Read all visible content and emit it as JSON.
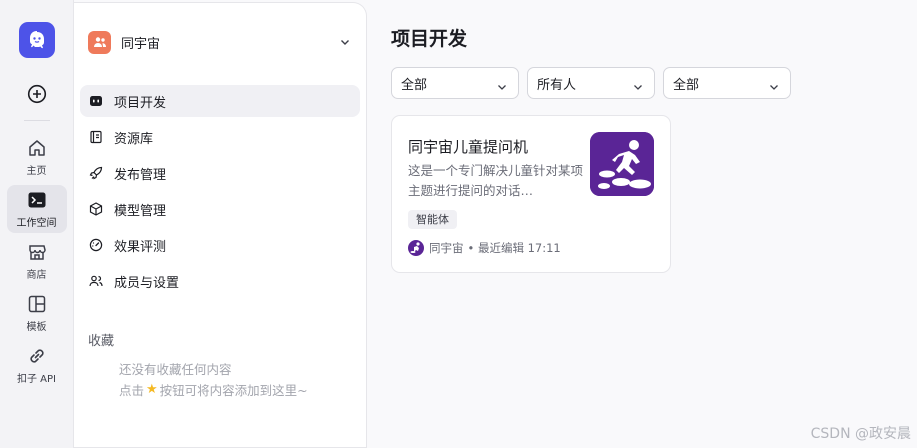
{
  "rail": {
    "items": [
      {
        "label": "主页",
        "icon": "home-icon"
      },
      {
        "label": "工作空间",
        "icon": "terminal-icon"
      },
      {
        "label": "商店",
        "icon": "store-icon"
      },
      {
        "label": "模板",
        "icon": "template-icon"
      },
      {
        "label": "扣子 API",
        "icon": "link-icon"
      }
    ]
  },
  "space": {
    "name": "同宇宙"
  },
  "nav": {
    "items": [
      {
        "label": "项目开发"
      },
      {
        "label": "资源库"
      },
      {
        "label": "发布管理"
      },
      {
        "label": "模型管理"
      },
      {
        "label": "效果评测"
      },
      {
        "label": "成员与设置"
      }
    ]
  },
  "favorites": {
    "title": "收藏",
    "empty_line1": "还没有收藏任何内容",
    "empty_line2_before": "点击",
    "empty_line2_after": "按钮可将内容添加到这里~"
  },
  "main": {
    "title": "项目开发",
    "filters": [
      {
        "value": "全部"
      },
      {
        "value": "所有人"
      },
      {
        "value": "全部"
      }
    ],
    "card": {
      "title": "同宇宙儿童提问机",
      "description": "这是一个专门解决儿童针对某项主题进行提问的对话…",
      "tag": "智能体",
      "owner": "同宇宙",
      "edited": "• 最近编辑 17:11"
    }
  },
  "watermark": "CSDN @政安晨",
  "colors": {
    "accent": "#4d53e8",
    "space_avatar": "#ef7a5b",
    "card_thumb": "#5a2596"
  }
}
